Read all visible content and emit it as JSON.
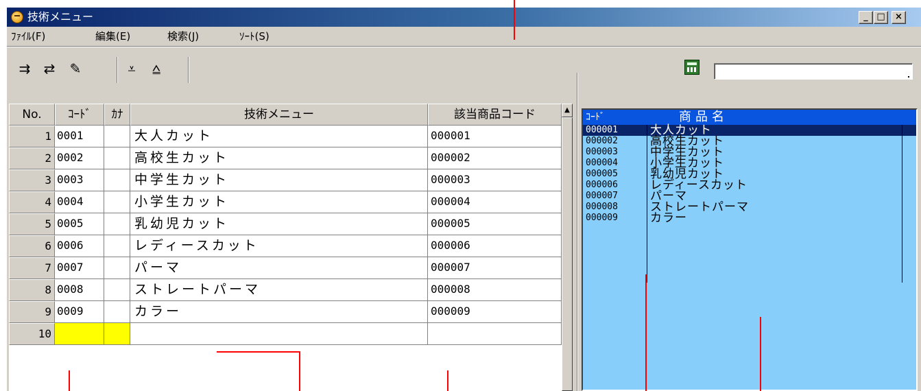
{
  "window": {
    "title": "技術メニュー",
    "buttons": {
      "minimize": "_",
      "maximize": "□",
      "close": "×"
    }
  },
  "menu": [
    {
      "label": "ﾌｧｲﾙ(F)"
    },
    {
      "label": "編集(E)"
    },
    {
      "label": "検索(J)"
    },
    {
      "label": "ｿｰﾄ(S)"
    }
  ],
  "toolbar": {
    "icons": [
      "insert-row-icon",
      "import-icon",
      "eraser-icon",
      "move-down-icon",
      "move-up-icon",
      "calculator-icon"
    ],
    "glyphs": {
      "insert": "⇉",
      "import": "⇄",
      "eraser": "✎",
      "down": "⩡",
      "up": "⩠"
    },
    "search_value": ""
  },
  "grid": {
    "headers": {
      "no": "No.",
      "code": "ｺｰﾄﾞ",
      "kana": "ｶﾅ",
      "menu": "技術メニュー",
      "product_code": "該当商品コード"
    },
    "rows": [
      {
        "no": "1",
        "code": "0001",
        "kana": "",
        "name": "大人カット",
        "product_code": "000001"
      },
      {
        "no": "2",
        "code": "0002",
        "kana": "",
        "name": "高校生カット",
        "product_code": "000002"
      },
      {
        "no": "3",
        "code": "0003",
        "kana": "",
        "name": "中学生カット",
        "product_code": "000003"
      },
      {
        "no": "4",
        "code": "0004",
        "kana": "",
        "name": "小学生カット",
        "product_code": "000004"
      },
      {
        "no": "5",
        "code": "0005",
        "kana": "",
        "name": "乳幼児カット",
        "product_code": "000005"
      },
      {
        "no": "6",
        "code": "0006",
        "kana": "",
        "name": "レディースカット",
        "product_code": "000006"
      },
      {
        "no": "7",
        "code": "0007",
        "kana": "",
        "name": "パーマ",
        "product_code": "000007"
      },
      {
        "no": "8",
        "code": "0008",
        "kana": "",
        "name": "ストレートパーマ",
        "product_code": "000008"
      },
      {
        "no": "9",
        "code": "0009",
        "kana": "",
        "name": "カラー",
        "product_code": "000009"
      },
      {
        "no": "10",
        "code": "",
        "kana": "",
        "name": "",
        "product_code": ""
      }
    ],
    "scroll_up": "▲"
  },
  "product_list": {
    "headers": {
      "code": "ｺｰﾄﾞ",
      "name": "商品名"
    },
    "items": [
      {
        "code": "000001",
        "name": "大人カット"
      },
      {
        "code": "000002",
        "name": "高校生カット"
      },
      {
        "code": "000003",
        "name": "中学生カット"
      },
      {
        "code": "000004",
        "name": "小学生カット"
      },
      {
        "code": "000005",
        "name": "乳幼児カット"
      },
      {
        "code": "000006",
        "name": " レディースカット"
      },
      {
        "code": "000007",
        "name": "パーマ"
      },
      {
        "code": "000008",
        "name": "ストレートパーマ"
      },
      {
        "code": "000009",
        "name": "カラー"
      }
    ]
  },
  "colors": {
    "title_gradient_start": "#0a246a",
    "active_cell": "#ffff00",
    "list_background": "#87cefa",
    "list_header": "#0a55e0",
    "annotation": "#ff0000"
  }
}
